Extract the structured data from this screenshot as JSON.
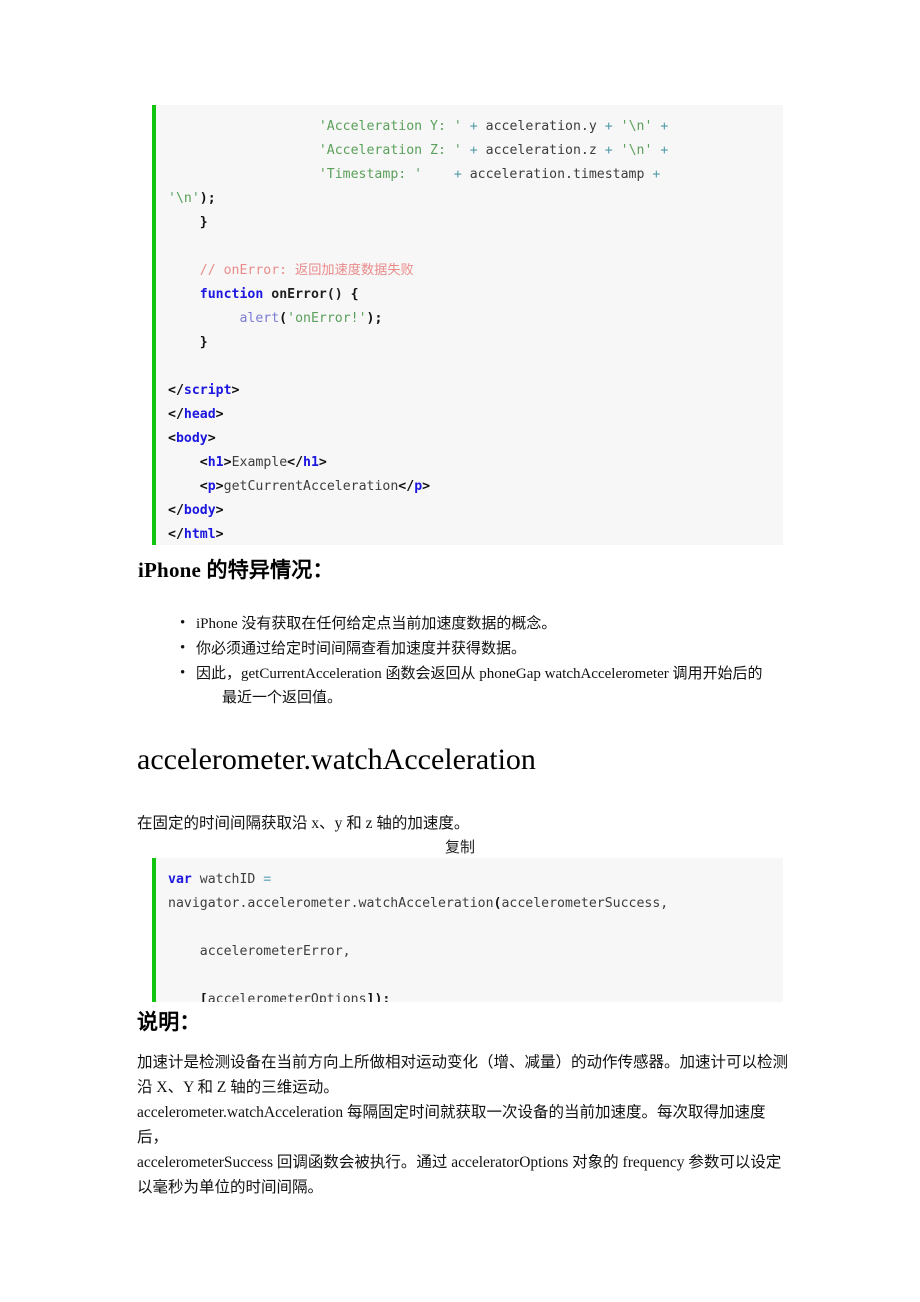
{
  "document": {
    "theme": {
      "page_bg": "#ffffff",
      "code_bg": "#f7f7f7",
      "code_accent": "#10c410",
      "string_color": "#5ba05b",
      "keyword_color": "#1b16e0",
      "comment_color": "#e98b8b",
      "operator_color": "#4f9aa8",
      "call_color": "#7b7bd4",
      "text_color": "#111111"
    }
  },
  "code_block_1": {
    "lines": [
      [
        {
          "t": "plain",
          "v": "                   "
        },
        {
          "t": "str",
          "v": "'Acceleration Y: '"
        },
        {
          "t": "plain",
          "v": " "
        },
        {
          "t": "op",
          "v": "+"
        },
        {
          "t": "plain",
          "v": " acceleration.y "
        },
        {
          "t": "op",
          "v": "+"
        },
        {
          "t": "plain",
          "v": " "
        },
        {
          "t": "str",
          "v": "'\\n'"
        },
        {
          "t": "plain",
          "v": " "
        },
        {
          "t": "op",
          "v": "+"
        }
      ],
      [
        {
          "t": "plain",
          "v": "                   "
        },
        {
          "t": "str",
          "v": "'Acceleration Z: '"
        },
        {
          "t": "plain",
          "v": " "
        },
        {
          "t": "op",
          "v": "+"
        },
        {
          "t": "plain",
          "v": " acceleration.z "
        },
        {
          "t": "op",
          "v": "+"
        },
        {
          "t": "plain",
          "v": " "
        },
        {
          "t": "str",
          "v": "'\\n'"
        },
        {
          "t": "plain",
          "v": " "
        },
        {
          "t": "op",
          "v": "+"
        }
      ],
      [
        {
          "t": "plain",
          "v": "                   "
        },
        {
          "t": "str",
          "v": "'Timestamp: '"
        },
        {
          "t": "plain",
          "v": "    "
        },
        {
          "t": "op",
          "v": "+"
        },
        {
          "t": "plain",
          "v": " acceleration.timestamp "
        },
        {
          "t": "op",
          "v": "+"
        }
      ],
      [
        {
          "t": "str",
          "v": "'\\n'"
        },
        {
          "t": "punc",
          "v": ");"
        }
      ],
      [
        {
          "t": "plain",
          "v": "    "
        },
        {
          "t": "punc",
          "v": "}"
        }
      ],
      [],
      [
        {
          "t": "plain",
          "v": "    "
        },
        {
          "t": "com",
          "v": "// onError: 返回加速度数据失败"
        }
      ],
      [
        {
          "t": "plain",
          "v": "    "
        },
        {
          "t": "kw",
          "v": "function"
        },
        {
          "t": "plain",
          "v": " "
        },
        {
          "t": "fn",
          "v": "onError()"
        },
        {
          "t": "plain",
          "v": " "
        },
        {
          "t": "punc",
          "v": "{"
        }
      ],
      [
        {
          "t": "plain",
          "v": "         "
        },
        {
          "t": "call",
          "v": "alert"
        },
        {
          "t": "punc",
          "v": "("
        },
        {
          "t": "str",
          "v": "'onError!'"
        },
        {
          "t": "punc",
          "v": ");"
        }
      ],
      [
        {
          "t": "plain",
          "v": "    "
        },
        {
          "t": "punc",
          "v": "}"
        }
      ],
      [],
      [
        {
          "t": "angle",
          "v": "</"
        },
        {
          "t": "tag",
          "v": "script"
        },
        {
          "t": "angle",
          "v": ">"
        }
      ],
      [
        {
          "t": "angle",
          "v": "</"
        },
        {
          "t": "tag",
          "v": "head"
        },
        {
          "t": "angle",
          "v": ">"
        }
      ],
      [
        {
          "t": "angle",
          "v": "<"
        },
        {
          "t": "tag",
          "v": "body"
        },
        {
          "t": "angle",
          "v": ">"
        }
      ],
      [
        {
          "t": "plain",
          "v": "    "
        },
        {
          "t": "angle",
          "v": "<"
        },
        {
          "t": "tag",
          "v": "h1"
        },
        {
          "t": "angle",
          "v": ">"
        },
        {
          "t": "plain",
          "v": "Example"
        },
        {
          "t": "angle",
          "v": "</"
        },
        {
          "t": "tag",
          "v": "h1"
        },
        {
          "t": "angle",
          "v": ">"
        }
      ],
      [
        {
          "t": "plain",
          "v": "    "
        },
        {
          "t": "angle",
          "v": "<"
        },
        {
          "t": "tag",
          "v": "p"
        },
        {
          "t": "angle",
          "v": ">"
        },
        {
          "t": "plain",
          "v": "getCurrentAcceleration"
        },
        {
          "t": "angle",
          "v": "</"
        },
        {
          "t": "tag",
          "v": "p"
        },
        {
          "t": "angle",
          "v": ">"
        }
      ],
      [
        {
          "t": "angle",
          "v": "</"
        },
        {
          "t": "tag",
          "v": "body"
        },
        {
          "t": "angle",
          "v": ">"
        }
      ],
      [
        {
          "t": "angle",
          "v": "</"
        },
        {
          "t": "tag",
          "v": "html"
        },
        {
          "t": "angle",
          "v": ">"
        }
      ]
    ]
  },
  "section_iphone": {
    "heading": "iPhone 的特异情况：",
    "bullets": [
      {
        "text": "iPhone 没有获取在任何给定点当前加速度数据的概念。",
        "cont": ""
      },
      {
        "text": "你必须通过给定时间间隔查看加速度并获得数据。",
        "cont": ""
      },
      {
        "text": "因此，getCurrentAcceleration 函数会返回从 phoneGap watchAccelerometer 调用开始后的",
        "cont": "最近一个返回值。"
      }
    ]
  },
  "section_watch": {
    "heading": "accelerometer.watchAcceleration",
    "intro": "在固定的时间间隔获取沿 x、y 和 z 轴的加速度。",
    "copy_label": "复制"
  },
  "code_block_2": {
    "lines": [
      [
        {
          "t": "kw",
          "v": "var"
        },
        {
          "t": "plain",
          "v": " watchID "
        },
        {
          "t": "eq",
          "v": "="
        }
      ],
      [
        {
          "t": "plain",
          "v": "navigator.accelerometer.watchAcceleration"
        },
        {
          "t": "punc",
          "v": "("
        },
        {
          "t": "plain",
          "v": "accelerometerSuccess,"
        }
      ],
      [],
      [
        {
          "t": "plain",
          "v": "    accelerometerError,"
        }
      ],
      [],
      [
        {
          "t": "plain",
          "v": "    "
        },
        {
          "t": "punc",
          "v": "["
        },
        {
          "t": "plain",
          "v": "accelerometerOptions"
        },
        {
          "t": "punc",
          "v": "]);"
        }
      ]
    ]
  },
  "section_desc": {
    "heading": "说明：",
    "paragraph_1_lines": [
      "加速计是检测设备在当前方向上所做相对运动变化（增、减量）的动作传感器。加速计可以检测",
      "沿 X、Y 和 Z 轴的三维运动。"
    ],
    "paragraph_2_lines": [
      "accelerometer.watchAcceleration 每隔固定时间就获取一次设备的当前加速度。每次取得加速度后，",
      "accelerometerSuccess 回调函数会被执行。通过 acceleratorOptions 对象的 frequency 参数可以设定",
      "以毫秒为单位的时间间隔。"
    ]
  }
}
